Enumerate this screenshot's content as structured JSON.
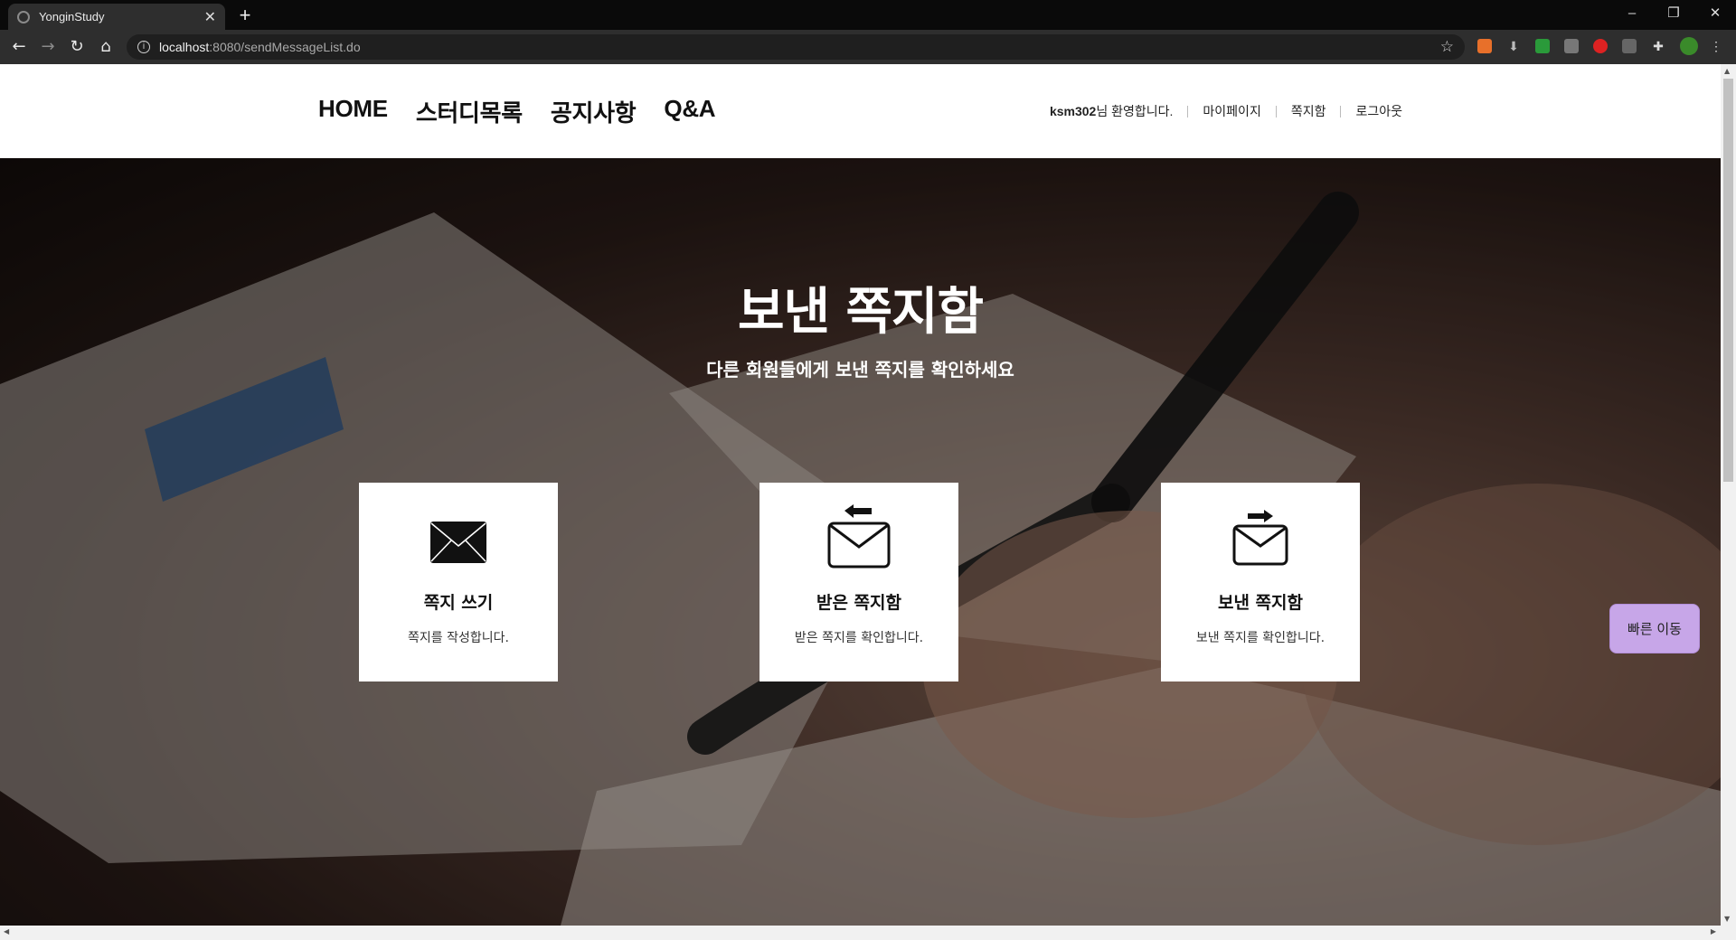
{
  "browser": {
    "tab_title": "YonginStudy",
    "url_host": "localhost",
    "url_rest": ":8080/sendMessageList.do",
    "new_tab": "+",
    "close": "✕",
    "minimize": "–",
    "restore": "❐",
    "window_close": "✕"
  },
  "nav": {
    "home": "HOME",
    "study_list": "스터디목록",
    "notice": "공지사항",
    "qna": "Q&A"
  },
  "user": {
    "username": "ksm302",
    "welcome_suffix": "님 환영합니다.",
    "mypage": "마이페이지",
    "messagebox": "쪽지함",
    "logout": "로그아웃"
  },
  "hero": {
    "title": "보낸 쪽지함",
    "subtitle": "다른 회원들에게 보낸 쪽지를 확인하세요"
  },
  "cards": [
    {
      "title": "쪽지 쓰기",
      "desc": "쪽지를 작성합니다."
    },
    {
      "title": "받은 쪽지함",
      "desc": "받은 쪽지를 확인합니다."
    },
    {
      "title": "보낸 쪽지함",
      "desc": "보낸 쪽지를 확인합니다."
    }
  ],
  "quick_move": "빠른 이동",
  "colors": {
    "quick_move_bg": "#c7a6e8",
    "chrome_dark": "#2e2e2e"
  }
}
